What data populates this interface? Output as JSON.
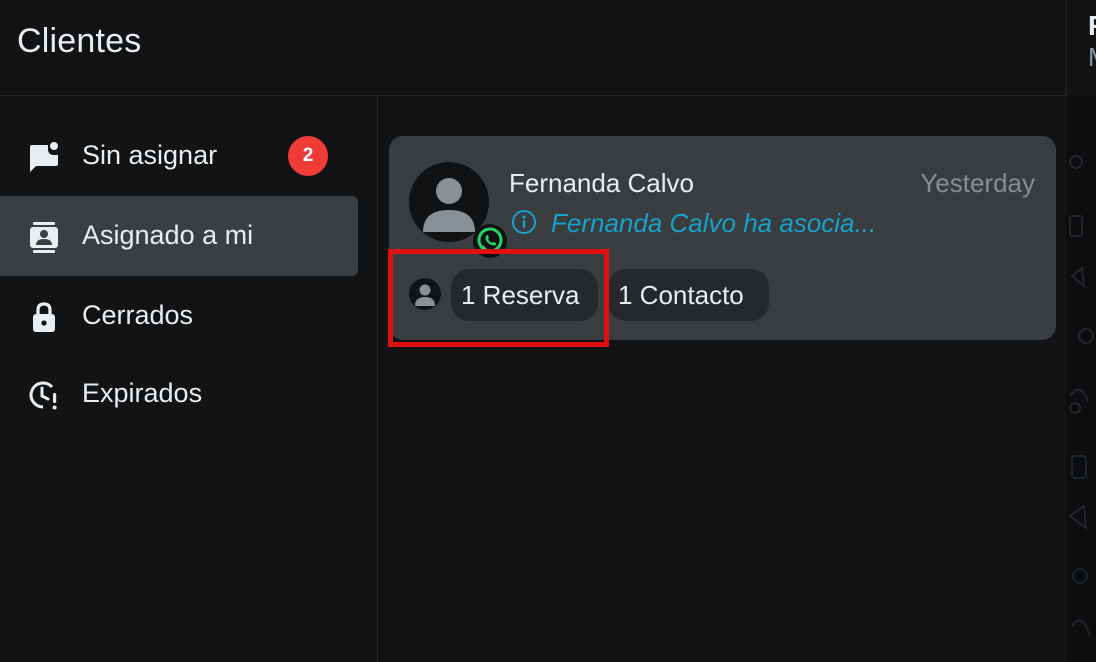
{
  "header": {
    "title": "Clientes"
  },
  "right_panel": {
    "line1": "F",
    "line2": "M"
  },
  "sidebar": {
    "items": [
      {
        "label": "Sin asignar",
        "badge": "2",
        "icon": "chat-add-icon",
        "active": false
      },
      {
        "label": "Asignado a mi",
        "icon": "contact-card-icon",
        "active": true
      },
      {
        "label": "Cerrados",
        "icon": "lock-icon",
        "active": false
      },
      {
        "label": "Expirados",
        "icon": "clock-alert-icon",
        "active": false
      }
    ]
  },
  "conversations": [
    {
      "name": "Fernanda Calvo",
      "time": "Yesterday",
      "preview": "Fernanda Calvo ha asocia...",
      "channel_icon": "whatsapp-icon",
      "chips": [
        "1 Reserva",
        "1 Contacto"
      ]
    }
  ],
  "colors": {
    "background": "#111315",
    "active_item": "#3b3f42",
    "badge": "#ef3b36",
    "card": "#3a3d40",
    "preview_text": "#16a2c9",
    "whatsapp": "#25d366",
    "highlight": "#e11010"
  }
}
